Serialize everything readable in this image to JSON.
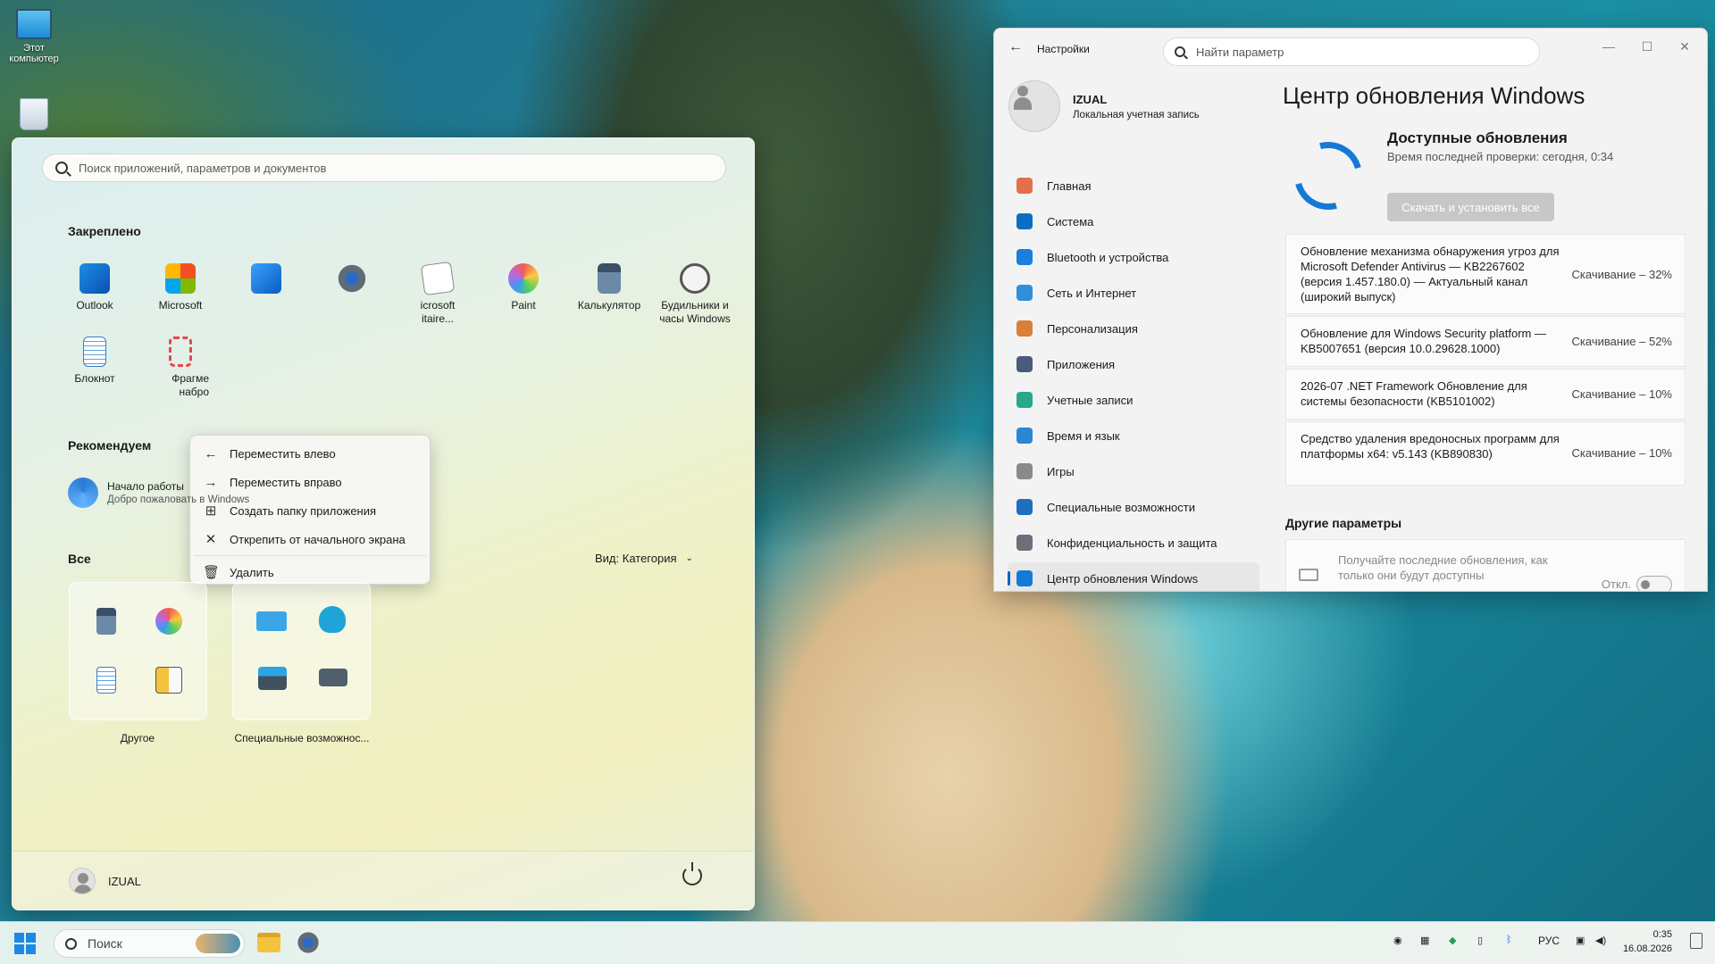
{
  "desktop": {
    "this_pc_label": "Этот компьютер"
  },
  "start_menu": {
    "search_placeholder": "Поиск приложений, параметров и документов",
    "pinned_title": "Закреплено",
    "pinned": [
      {
        "label": "Outlook",
        "icon": "outlook-icon"
      },
      {
        "label": "Microsoft",
        "icon": "store-icon"
      },
      {
        "label": "",
        "icon": "photos-icon"
      },
      {
        "label": "",
        "icon": "settings-gear-icon"
      },
      {
        "label": "icrosoft\nitaire...",
        "icon": "solitaire-icon"
      },
      {
        "label": "Paint",
        "icon": "paint-icon"
      },
      {
        "label": "Калькулятор",
        "icon": "calculator-icon"
      },
      {
        "label": "Будильники и\nчасы Windows",
        "icon": "alarm-clock-icon"
      },
      {
        "label": "Блокнот",
        "icon": "notepad-icon"
      },
      {
        "label": "Фрагме\nнабро",
        "icon": "snipping-tool-icon"
      }
    ],
    "context_menu": {
      "move_left": "Переместить влево",
      "move_right": "Переместить вправо",
      "create_folder": "Создать папку приложения",
      "unpin": "Открепить от начального экрана",
      "delete": "Удалить"
    },
    "recommended_title": "Рекомендуем",
    "recommended": {
      "title": "Начало работы",
      "subtitle": "Добро пожаловать в Windows"
    },
    "all_title": "Все",
    "view_label": "Вид: Категория",
    "folders": [
      {
        "label": "Другое"
      },
      {
        "label": "Специальные возможнос..."
      }
    ],
    "user_name": "IZUAL"
  },
  "settings": {
    "app_title": "Настройки",
    "search_placeholder": "Найти параметр",
    "user_name": "IZUAL",
    "user_subtitle": "Локальная учетная запись",
    "nav": [
      {
        "label": "Главная",
        "icon": "home-icon",
        "color": "#e4704a"
      },
      {
        "label": "Система",
        "icon": "system-icon",
        "color": "#0a6fc2"
      },
      {
        "label": "Bluetooth и устройства",
        "icon": "bluetooth-icon",
        "color": "#1a7fdc"
      },
      {
        "label": "Сеть и Интернет",
        "icon": "wifi-icon",
        "color": "#2f8fd8"
      },
      {
        "label": "Персонализация",
        "icon": "brush-icon",
        "color": "#d8803a"
      },
      {
        "label": "Приложения",
        "icon": "apps-icon",
        "color": "#4a5a78"
      },
      {
        "label": "Учетные записи",
        "icon": "accounts-icon",
        "color": "#27a887"
      },
      {
        "label": "Время и язык",
        "icon": "time-language-icon",
        "color": "#2a86d4"
      },
      {
        "label": "Игры",
        "icon": "gaming-icon",
        "color": "#8a8a8a"
      },
      {
        "label": "Специальные возможности",
        "icon": "accessibility-icon",
        "color": "#1f6fbe"
      },
      {
        "label": "Конфиденциальность и защита",
        "icon": "shield-icon",
        "color": "#6a6f78"
      },
      {
        "label": "Центр обновления Windows",
        "icon": "windows-update-icon",
        "color": "#1579d6"
      }
    ],
    "page_title": "Центр обновления Windows",
    "available_title": "Доступные обновления",
    "last_check": "Время последней проверки: сегодня, 0:34",
    "install_all": "Скачать и установить все",
    "updates": [
      {
        "desc": "Обновление механизма обнаружения угроз для Microsoft Defender Antivirus — KB2267602 (версия 1.457.180.0) — Актуальный канал (широкий выпуск)",
        "status": "Скачивание – 32%"
      },
      {
        "desc": "Обновление для Windows Security platform — KB5007651 (версия 10.0.29628.1000)",
        "status": "Скачивание – 52%"
      },
      {
        "desc": "2026-07 .NET Framework Обновление для системы безопасности (KB5101002)",
        "status": "Скачивание – 10%"
      },
      {
        "desc": "Средство удаления вредоносных программ для платформы x64: v5.143 (KB890830)",
        "status": "Скачивание – 10%"
      }
    ],
    "other_title": "Другие параметры",
    "latest_updates_text": "Получайте последние обновления, как только они будут доступны",
    "toggle_state": "Откл."
  },
  "taskbar": {
    "search_placeholder": "Поиск",
    "language": "РУС",
    "time": "0:35",
    "date": "16.08.2026"
  }
}
